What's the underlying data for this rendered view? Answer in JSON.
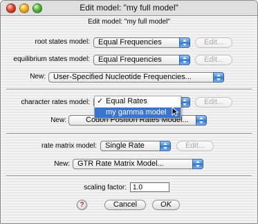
{
  "window": {
    "title": "Edit model: \"my full model\""
  },
  "dialog": {
    "subtitle": "Edit model: \"my full model\""
  },
  "root": {
    "label": "root states model:",
    "value": "Equal Frequencies",
    "edit": "Edit..."
  },
  "equilibrium": {
    "label": "equilibrium states model:",
    "value": "Equal Frequencies",
    "edit": "Edit..."
  },
  "new1": {
    "label": "New:",
    "value": "User-Specified Nucleotide Frequencies..."
  },
  "charrates": {
    "label": "character rates model:",
    "value": "Equal Rates",
    "edit": "Edit..."
  },
  "charrates_menu": {
    "items": [
      "Equal Rates",
      "my gamma model"
    ],
    "selected_index": 0,
    "check": "✓"
  },
  "new2": {
    "label": "New:",
    "value": "Codon Position Rates Model..."
  },
  "ratematrix": {
    "label": "rate matrix model:",
    "value": "Single Rate",
    "edit": "Edit..."
  },
  "new3": {
    "label": "New:",
    "value": "GTR Rate Matrix Model..."
  },
  "scaling": {
    "label": "scaling factor:",
    "value": "1.0"
  },
  "buttons": {
    "help": "?",
    "cancel": "Cancel",
    "ok": "OK"
  },
  "colors": {
    "accent": "#3a74d2",
    "popup_arrow": "#2d74cf"
  }
}
